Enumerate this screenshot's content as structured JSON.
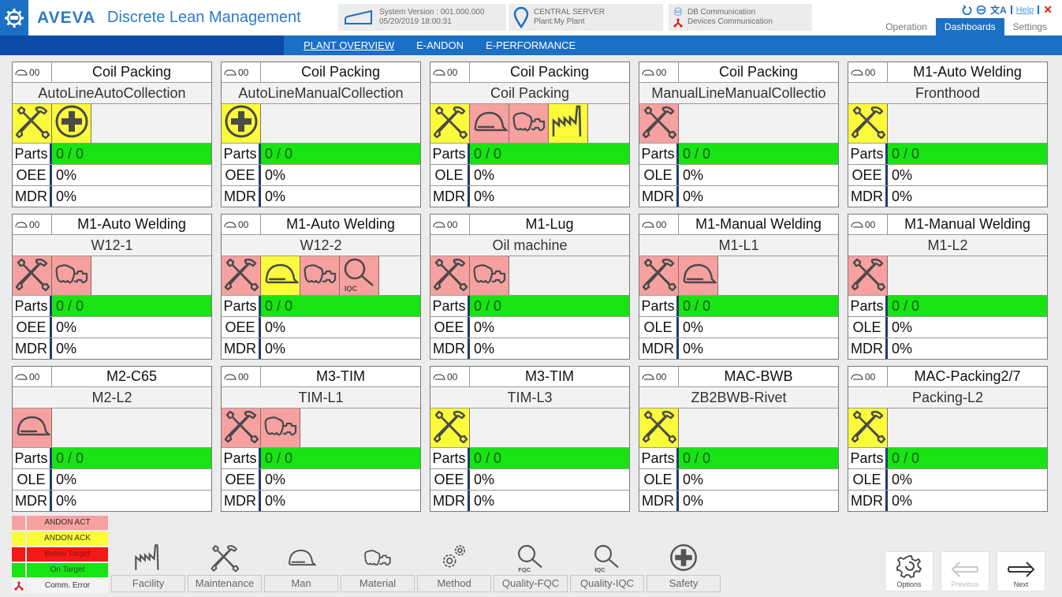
{
  "header": {
    "brand": "AVEVA",
    "app_title": "Discrete Lean Management",
    "system_version": "System Version : 001.000.000",
    "datetime": "05/20/2019 18:00:31",
    "server_name": "CENTRAL SERVER",
    "plant": "Plant:My Plant",
    "db_comm": "DB Communication",
    "devices_comm": "Devices Communication",
    "help_label": "Help",
    "main_tabs": [
      {
        "label": "Operation",
        "active": false
      },
      {
        "label": "Dashboards",
        "active": true
      },
      {
        "label": "Settings",
        "active": false
      }
    ]
  },
  "nav": {
    "links": [
      {
        "label": "PLANT OVERVIEW",
        "active": true
      },
      {
        "label": "E-ANDON",
        "active": false
      },
      {
        "label": "E-PERFORMANCE",
        "active": false
      }
    ]
  },
  "colors": {
    "andon_act": "#f7a0a0",
    "andon_ack": "#fbfb3c",
    "below_target": "#f21a1a",
    "on_target": "#18e414",
    "brand_blue": "#1b6fc4",
    "nav_dark": "#0b4aa8"
  },
  "tiles": [
    {
      "shift": "00",
      "line": "Coil Packing",
      "station": "AutoLineAutoCollection",
      "andons": [
        {
          "type": "maintenance",
          "state": "ack"
        },
        {
          "type": "safety",
          "state": "ack"
        }
      ],
      "parts": "0 / 0",
      "metric2_label": "OEE",
      "metric2_value": "0%",
      "mdr": "0%"
    },
    {
      "shift": "00",
      "line": "Coil Packing",
      "station": "AutoLineManualCollection",
      "andons": [
        {
          "type": "safety",
          "state": "ack"
        }
      ],
      "parts": "0 / 0",
      "metric2_label": "OEE",
      "metric2_value": "0%",
      "mdr": "0%"
    },
    {
      "shift": "00",
      "line": "Coil Packing",
      "station": "Coil Packing",
      "andons": [
        {
          "type": "maintenance",
          "state": "ack"
        },
        {
          "type": "man",
          "state": "act"
        },
        {
          "type": "material",
          "state": "act"
        },
        {
          "type": "facility",
          "state": "ack"
        }
      ],
      "parts": "0 / 0",
      "metric2_label": "OLE",
      "metric2_value": "0%",
      "mdr": "0%"
    },
    {
      "shift": "00",
      "line": "Coil Packing",
      "station": "ManualLineManualCollectio",
      "andons": [
        {
          "type": "maintenance",
          "state": "act"
        }
      ],
      "parts": "0 / 0",
      "metric2_label": "OLE",
      "metric2_value": "0%",
      "mdr": "0%"
    },
    {
      "shift": "00",
      "line": "M1-Auto Welding",
      "station": "Fronthood",
      "andons": [
        {
          "type": "maintenance",
          "state": "ack"
        }
      ],
      "parts": "0 / 0",
      "metric2_label": "OEE",
      "metric2_value": "0%",
      "mdr": "0%"
    },
    {
      "shift": "00",
      "line": "M1-Auto Welding",
      "station": "W12-1",
      "andons": [
        {
          "type": "maintenance",
          "state": "act"
        },
        {
          "type": "material",
          "state": "act"
        }
      ],
      "parts": "0 / 0",
      "metric2_label": "OEE",
      "metric2_value": "0%",
      "mdr": "0%"
    },
    {
      "shift": "00",
      "line": "M1-Auto Welding",
      "station": "W12-2",
      "andons": [
        {
          "type": "maintenance",
          "state": "act"
        },
        {
          "type": "man",
          "state": "ack"
        },
        {
          "type": "material",
          "state": "act"
        },
        {
          "type": "quality-iqc",
          "state": "act"
        }
      ],
      "parts": "0 / 0",
      "metric2_label": "OEE",
      "metric2_value": "0%",
      "mdr": "0%"
    },
    {
      "shift": "00",
      "line": "M1-Lug",
      "station": "Oil machine",
      "andons": [
        {
          "type": "maintenance",
          "state": "act"
        },
        {
          "type": "material",
          "state": "act"
        }
      ],
      "parts": "0 / 0",
      "metric2_label": "OEE",
      "metric2_value": "0%",
      "mdr": "0%"
    },
    {
      "shift": "00",
      "line": "M1-Manual Welding",
      "station": "M1-L1",
      "andons": [
        {
          "type": "maintenance",
          "state": "act"
        },
        {
          "type": "man",
          "state": "act"
        }
      ],
      "parts": "0 / 0",
      "metric2_label": "OLE",
      "metric2_value": "0%",
      "mdr": "0%"
    },
    {
      "shift": "00",
      "line": "M1-Manual Welding",
      "station": "M1-L2",
      "andons": [
        {
          "type": "maintenance",
          "state": "act"
        }
      ],
      "parts": "0 / 0",
      "metric2_label": "OLE",
      "metric2_value": "0%",
      "mdr": "0%"
    },
    {
      "shift": "00",
      "line": "M2-C65",
      "station": "M2-L2",
      "andons": [
        {
          "type": "man",
          "state": "act"
        }
      ],
      "parts": "0 / 0",
      "metric2_label": "OLE",
      "metric2_value": "0%",
      "mdr": "0%"
    },
    {
      "shift": "00",
      "line": "M3-TIM",
      "station": "TIM-L1",
      "andons": [
        {
          "type": "maintenance",
          "state": "act"
        },
        {
          "type": "material",
          "state": "act"
        }
      ],
      "parts": "0 / 0",
      "metric2_label": "OEE",
      "metric2_value": "0%",
      "mdr": "0%"
    },
    {
      "shift": "00",
      "line": "M3-TIM",
      "station": "TIM-L3",
      "andons": [
        {
          "type": "maintenance",
          "state": "ack"
        }
      ],
      "parts": "0 / 0",
      "metric2_label": "OEE",
      "metric2_value": "0%",
      "mdr": "0%"
    },
    {
      "shift": "00",
      "line": "MAC-BWB",
      "station": "ZB2BWB-Rivet",
      "andons": [
        {
          "type": "maintenance",
          "state": "ack"
        }
      ],
      "parts": "0 / 0",
      "metric2_label": "OLE",
      "metric2_value": "0%",
      "mdr": "0%"
    },
    {
      "shift": "00",
      "line": "MAC-Packing2/7",
      "station": "Packing-L2",
      "andons": [
        {
          "type": "maintenance",
          "state": "ack"
        }
      ],
      "parts": "0 / 0",
      "metric2_label": "OLE",
      "metric2_value": "0%",
      "mdr": "0%"
    }
  ],
  "labels": {
    "parts": "Parts",
    "mdr": "MDR"
  },
  "legend": [
    {
      "label": "ANDON ACT",
      "color": "#f7a0a0",
      "text_color": "#333333"
    },
    {
      "label": "ANDON ACK",
      "color": "#fbfb3c",
      "text_color": "#333333"
    },
    {
      "label": "Below Target",
      "color": "#f21a1a",
      "text_color": "#8a1010"
    },
    {
      "label": "On Target",
      "color": "#18e414",
      "text_color": "#225522"
    },
    {
      "label": "Comm. Error",
      "color": "#f4f4f4",
      "text_color": "#333333",
      "icon": "comm-error-icon"
    }
  ],
  "categories": [
    {
      "key": "facility",
      "label": "Facility"
    },
    {
      "key": "maintenance",
      "label": "Maintenance"
    },
    {
      "key": "man",
      "label": "Man"
    },
    {
      "key": "material",
      "label": "Material"
    },
    {
      "key": "method",
      "label": "Method"
    },
    {
      "key": "quality-fqc",
      "label": "Quality-FQC",
      "badge": "FQC"
    },
    {
      "key": "quality-iqc",
      "label": "Quality-IQC",
      "badge": "IQC"
    },
    {
      "key": "safety",
      "label": "Safety"
    }
  ],
  "actions": {
    "options": "Options",
    "previous": "Previous",
    "next": "Next"
  }
}
